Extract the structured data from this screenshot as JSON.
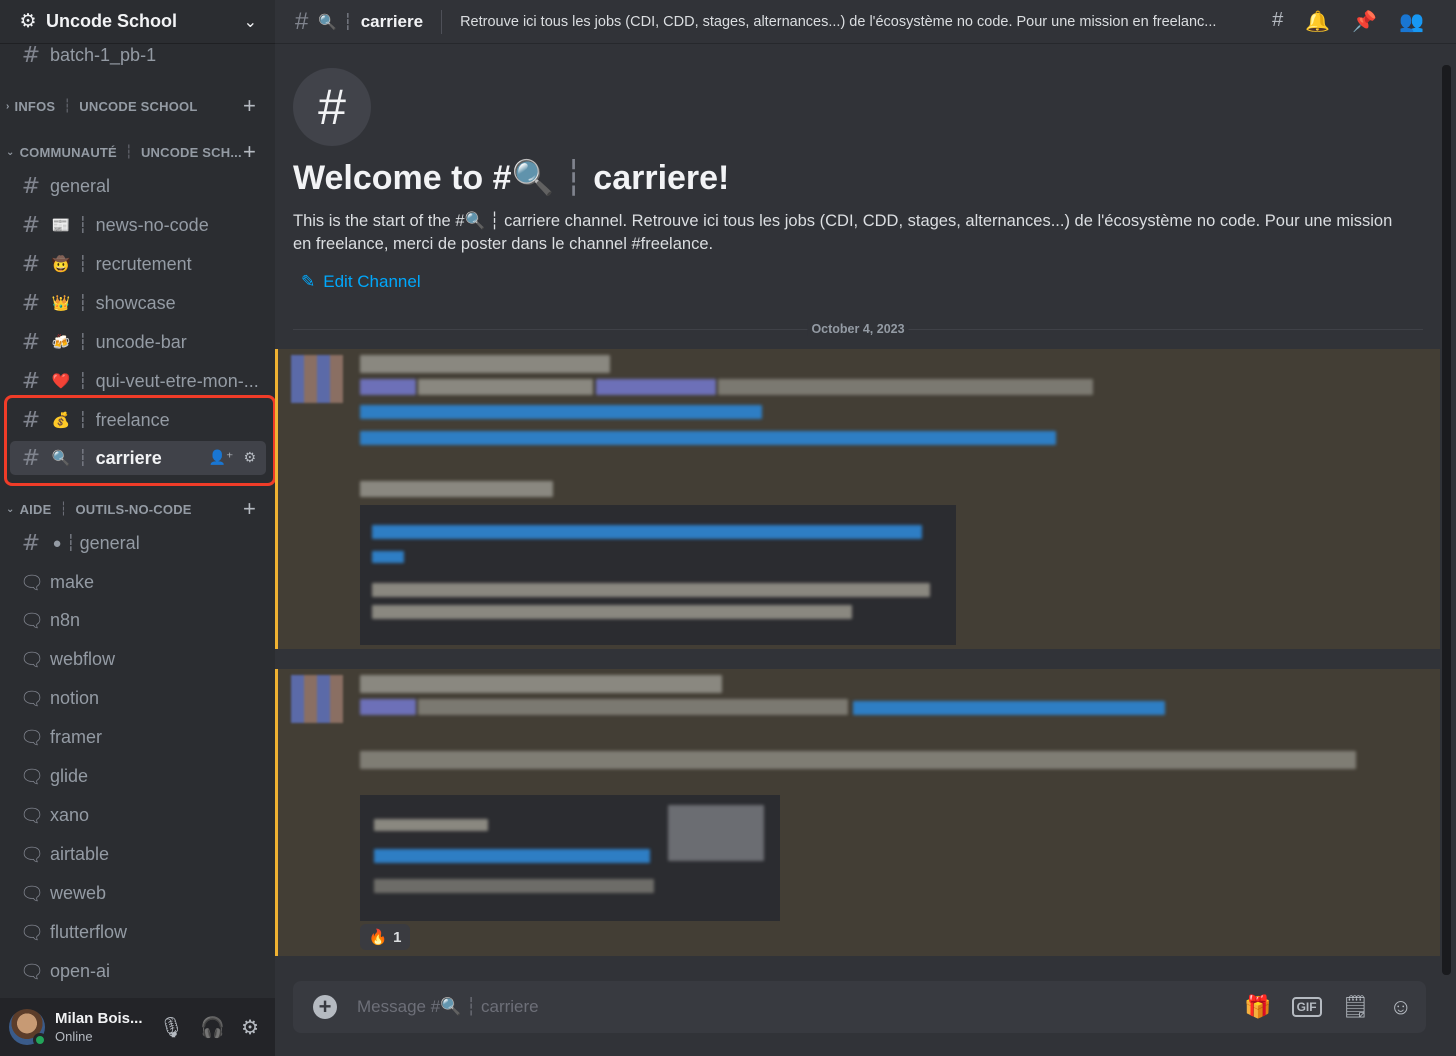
{
  "server": {
    "name": "Uncode School"
  },
  "sidebar": {
    "top_channel": "batch-1_pb-1",
    "categories": [
      {
        "name": "INFOS",
        "sub": "UNCODE SCHOOL"
      },
      {
        "name": "COMMUNAUTÉ",
        "sub": "UNCODE SCH..."
      },
      {
        "name": "AIDE",
        "sub": "OUTILS-NO-CODE"
      }
    ],
    "community_channels": [
      {
        "emoji": "",
        "label": "general"
      },
      {
        "emoji": "📰",
        "label": "news-no-code"
      },
      {
        "emoji": "🤠",
        "label": "recrutement"
      },
      {
        "emoji": "👑",
        "label": "showcase"
      },
      {
        "emoji": "🍻",
        "label": "uncode-bar"
      },
      {
        "emoji": "❤️",
        "label": "qui-veut-etre-mon-..."
      },
      {
        "emoji": "💰",
        "label": "freelance"
      },
      {
        "emoji": "🔍",
        "label": "carriere"
      }
    ],
    "aide_general": {
      "emoji": "●",
      "label": "general"
    },
    "forums": [
      "make",
      "n8n",
      "webflow",
      "notion",
      "framer",
      "glide",
      "xano",
      "airtable",
      "weweb",
      "flutterflow",
      "open-ai"
    ]
  },
  "user": {
    "name": "Milan Bois...",
    "status": "Online"
  },
  "topbar": {
    "channel_emoji": "🔍",
    "channel_name": "carriere",
    "topic": "Retrouve ici tous les jobs (CDI, CDD, stages, alternances...) de l'écosystème no code. Pour une mission en freelanc..."
  },
  "main": {
    "welcome_prefix": "Welcome to #",
    "welcome_emoji": "🔍",
    "welcome_name": "carriere!",
    "intro": "This is the start of the #🔍 ┆ carriere channel. Retrouve ici tous les jobs (CDI, CDD, stages, alternances...) de l'écosystème no code. Pour une mission en freelance, merci de poster dans le channel #freelance.",
    "edit_channel": "Edit Channel",
    "date": "October 4, 2023",
    "reaction_emoji": "🔥",
    "reaction_count": "1"
  },
  "composer": {
    "placeholder": "Message #🔍 ┆ carriere"
  },
  "colors": {
    "accent_link": "#00a8fc",
    "highlight": "#f03c28",
    "mention_bar": "#f0b232",
    "online": "#23a55a"
  }
}
